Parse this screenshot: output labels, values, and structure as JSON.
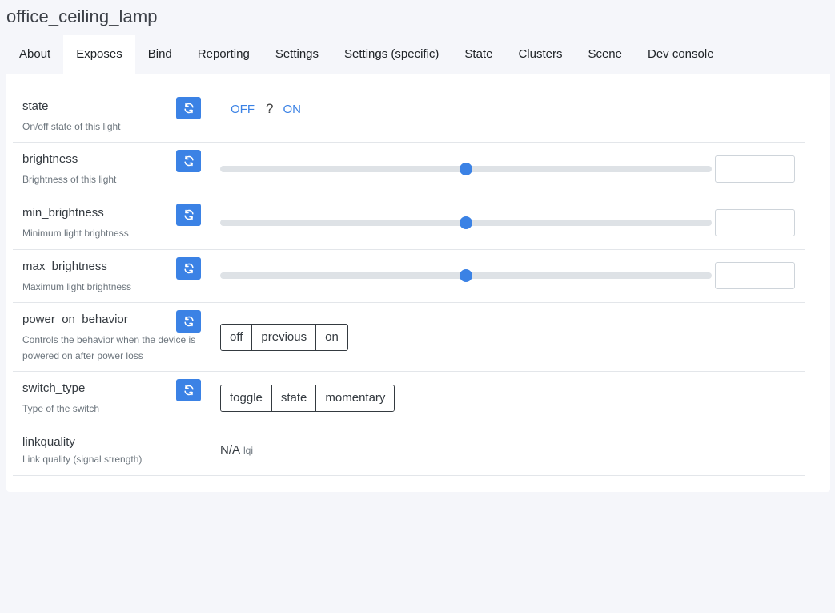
{
  "device": {
    "title": "office_ceiling_lamp"
  },
  "tabs": [
    {
      "label": "About",
      "active": false
    },
    {
      "label": "Exposes",
      "active": true
    },
    {
      "label": "Bind",
      "active": false
    },
    {
      "label": "Reporting",
      "active": false
    },
    {
      "label": "Settings",
      "active": false
    },
    {
      "label": "Settings (specific)",
      "active": false
    },
    {
      "label": "State",
      "active": false
    },
    {
      "label": "Clusters",
      "active": false
    },
    {
      "label": "Scene",
      "active": false
    },
    {
      "label": "Dev console",
      "active": false
    }
  ],
  "colors": {
    "accent": "#3b82e5",
    "link": "#3b82e5"
  },
  "refresh_icon": "refresh-icon",
  "exposes": {
    "state": {
      "name": "state",
      "description": "On/off state of this light",
      "off_label": "OFF",
      "unknown_label": "?",
      "on_label": "ON"
    },
    "brightness": {
      "name": "brightness",
      "description": "Brightness of this light",
      "slider_position": 0.5,
      "value": ""
    },
    "min_brightness": {
      "name": "min_brightness",
      "description": "Minimum light brightness",
      "slider_position": 0.5,
      "value": ""
    },
    "max_brightness": {
      "name": "max_brightness",
      "description": "Maximum light brightness",
      "slider_position": 0.5,
      "value": ""
    },
    "power_on_behavior": {
      "name": "power_on_behavior",
      "description": "Controls the behavior when the device is powered on after power loss",
      "options": [
        "off",
        "previous",
        "on"
      ]
    },
    "switch_type": {
      "name": "switch_type",
      "description": "Type of the switch",
      "options": [
        "toggle",
        "state",
        "momentary"
      ]
    },
    "linkquality": {
      "name": "linkquality",
      "description": "Link quality (signal strength)",
      "value": "N/A",
      "unit": "lqi"
    }
  }
}
